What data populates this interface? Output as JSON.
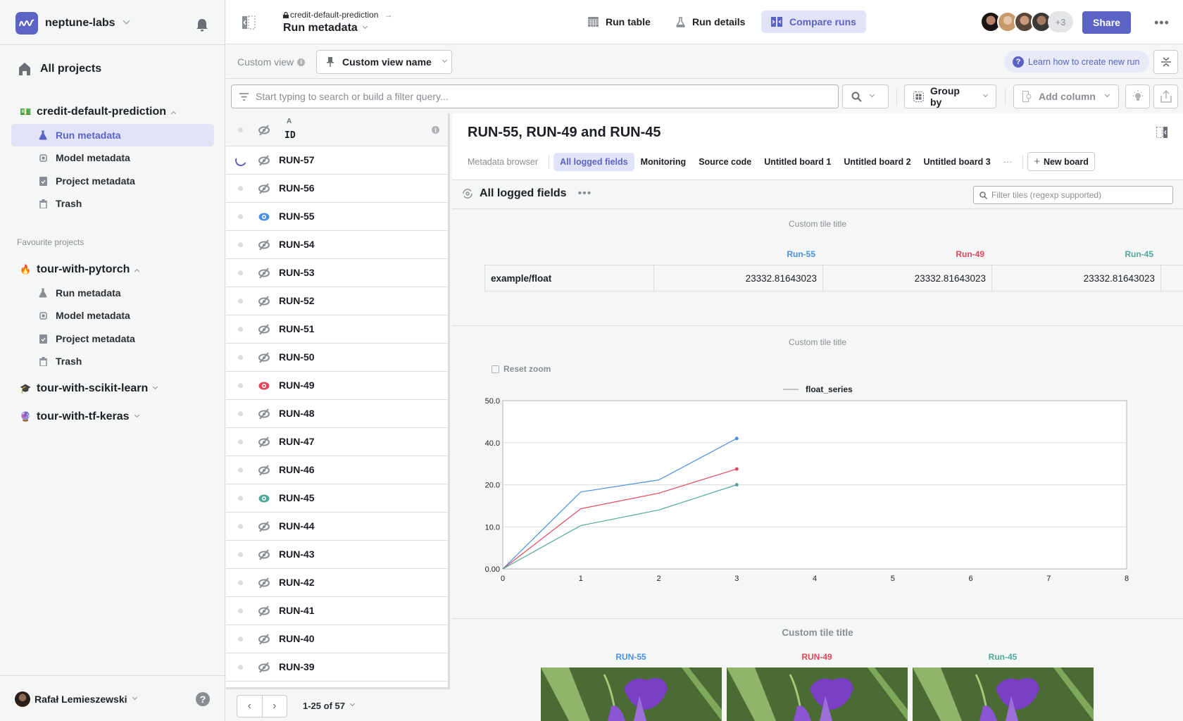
{
  "org": {
    "name": "neptune-labs",
    "logo_icon": "neptune-wave-icon"
  },
  "sidebar": {
    "all_projects": "All projects",
    "current_project": {
      "name": "credit-default-prediction",
      "emoji": "💵",
      "items": [
        {
          "label": "Run metadata",
          "icon": "flask-icon",
          "active": true
        },
        {
          "label": "Model metadata",
          "icon": "chip-icon",
          "active": false
        },
        {
          "label": "Project metadata",
          "icon": "clipboard-icon",
          "active": false
        },
        {
          "label": "Trash",
          "icon": "trash-icon",
          "active": false
        }
      ]
    },
    "favourites_label": "Favourite projects",
    "favourites": [
      {
        "name": "tour-with-pytorch",
        "emoji": "🔥",
        "expanded": true,
        "items": [
          {
            "label": "Run metadata",
            "icon": "flask-icon"
          },
          {
            "label": "Model metadata",
            "icon": "chip-icon"
          },
          {
            "label": "Project metadata",
            "icon": "clipboard-icon"
          },
          {
            "label": "Trash",
            "icon": "trash-icon"
          }
        ]
      },
      {
        "name": "tour-with-scikit-learn",
        "emoji": "🎓",
        "expanded": false
      },
      {
        "name": "tour-with-tf-keras",
        "emoji": "🔮",
        "expanded": false
      }
    ],
    "user": {
      "name": "Rafał Lemieszewski"
    },
    "help": "?"
  },
  "topbar": {
    "breadcrumb": "credit-default-prediction",
    "breadcrumb_arrow": "→",
    "title": "Run metadata",
    "nav": [
      {
        "label": "Run table",
        "icon": "table-icon",
        "active": false
      },
      {
        "label": "Run details",
        "icon": "flask-icon",
        "active": false
      },
      {
        "label": "Compare runs",
        "icon": "compare-icon",
        "active": true
      }
    ],
    "avatars_more": "+3",
    "share_label": "Share",
    "more": "•••"
  },
  "viewbar": {
    "label": "Custom view",
    "info": "i",
    "view_name": "Custom view name",
    "learn": "Learn how to create new run",
    "learn_q": "?"
  },
  "filterbar": {
    "placeholder": "Start typing to search or build a filter query...",
    "value": "",
    "group_by": "Group by",
    "add_column": "Add column"
  },
  "runs_table": {
    "sort_indicator": "A",
    "column_id": "ID",
    "rows": [
      {
        "id": "RUN-57",
        "status": "running",
        "visible": false,
        "color": ""
      },
      {
        "id": "RUN-56",
        "status": "idle",
        "visible": false,
        "color": ""
      },
      {
        "id": "RUN-55",
        "status": "idle",
        "visible": true,
        "color": "#4a90e2"
      },
      {
        "id": "RUN-54",
        "status": "idle",
        "visible": false,
        "color": ""
      },
      {
        "id": "RUN-53",
        "status": "idle",
        "visible": false,
        "color": ""
      },
      {
        "id": "RUN-52",
        "status": "idle",
        "visible": false,
        "color": ""
      },
      {
        "id": "RUN-51",
        "status": "idle",
        "visible": false,
        "color": ""
      },
      {
        "id": "RUN-50",
        "status": "idle",
        "visible": false,
        "color": ""
      },
      {
        "id": "RUN-49",
        "status": "idle",
        "visible": true,
        "color": "#e0475b"
      },
      {
        "id": "RUN-48",
        "status": "idle",
        "visible": false,
        "color": ""
      },
      {
        "id": "RUN-47",
        "status": "idle",
        "visible": false,
        "color": ""
      },
      {
        "id": "RUN-46",
        "status": "idle",
        "visible": false,
        "color": ""
      },
      {
        "id": "RUN-45",
        "status": "idle",
        "visible": true,
        "color": "#4fa899"
      },
      {
        "id": "RUN-44",
        "status": "idle",
        "visible": false,
        "color": ""
      },
      {
        "id": "RUN-43",
        "status": "idle",
        "visible": false,
        "color": ""
      },
      {
        "id": "RUN-42",
        "status": "idle",
        "visible": false,
        "color": ""
      },
      {
        "id": "RUN-41",
        "status": "idle",
        "visible": false,
        "color": ""
      },
      {
        "id": "RUN-40",
        "status": "idle",
        "visible": false,
        "color": ""
      },
      {
        "id": "RUN-39",
        "status": "idle",
        "visible": false,
        "color": ""
      }
    ],
    "pagination": "1-25 of 57",
    "prev": "‹",
    "next": "›"
  },
  "compare": {
    "title": "RUN-55, RUN-49 and RUN-45",
    "tabs": [
      {
        "label": "Metadata browser",
        "muted": true
      },
      {
        "label": "All logged fields",
        "active": true
      },
      {
        "label": "Monitoring"
      },
      {
        "label": "Source code"
      },
      {
        "label": "Untitled board 1"
      },
      {
        "label": "Untitled board 2"
      },
      {
        "label": "Untitled board 3"
      }
    ],
    "tabs_more": "···",
    "new_board": "New board",
    "board_title": "All logged fields",
    "board_more": "•••",
    "tile_filter_placeholder": "Filter tiles (regexp supported)",
    "tiles": [
      {
        "title": "Custom tile title",
        "type": "value-table",
        "runs": [
          {
            "label": "Run-55",
            "color": "#4a90e2"
          },
          {
            "label": "Run-49",
            "color": "#e0475b"
          },
          {
            "label": "Run-45",
            "color": "#4fa899"
          }
        ],
        "rows": [
          {
            "key": "example/float",
            "values": [
              "23332.81643023",
              "23332.81643023",
              "23332.81643023"
            ]
          }
        ]
      },
      {
        "title": "Custom tile title",
        "type": "chart",
        "reset_zoom": "Reset zoom"
      },
      {
        "title": "Custom tile title",
        "type": "images",
        "runs": [
          {
            "label": "RUN-55",
            "color": "#4a90e2"
          },
          {
            "label": "RUN-49",
            "color": "#e0475b"
          },
          {
            "label": "Run-45",
            "color": "#4fa899"
          }
        ]
      }
    ]
  },
  "chart_data": {
    "type": "line",
    "title": "",
    "legend": [
      "float_series"
    ],
    "legend_position": "top-center",
    "x": [
      0,
      1,
      2,
      3
    ],
    "xticks": [
      0,
      1,
      2,
      3,
      4,
      5,
      6,
      7,
      8
    ],
    "xlim": [
      0,
      8
    ],
    "yticks": [
      {
        "label": "0.00",
        "frac": 0.0
      },
      {
        "label": "10.0",
        "frac": 0.25
      },
      {
        "label": "20.0",
        "frac": 0.5
      },
      {
        "label": "40.0",
        "frac": 0.75
      },
      {
        "label": "50.0",
        "frac": 1.0
      }
    ],
    "ylim": [
      0,
      50
    ],
    "grid": true,
    "series": [
      {
        "name": "RUN-55",
        "color": "#4a90e2",
        "values": [
          0,
          18.3,
          22.3,
          41.0
        ]
      },
      {
        "name": "RUN-49",
        "color": "#e0475b",
        "values": [
          0,
          14.3,
          18.0,
          27.5
        ]
      },
      {
        "name": "RUN-45",
        "color": "#4fa899",
        "values": [
          0,
          10.3,
          14.0,
          20.0
        ]
      }
    ]
  }
}
